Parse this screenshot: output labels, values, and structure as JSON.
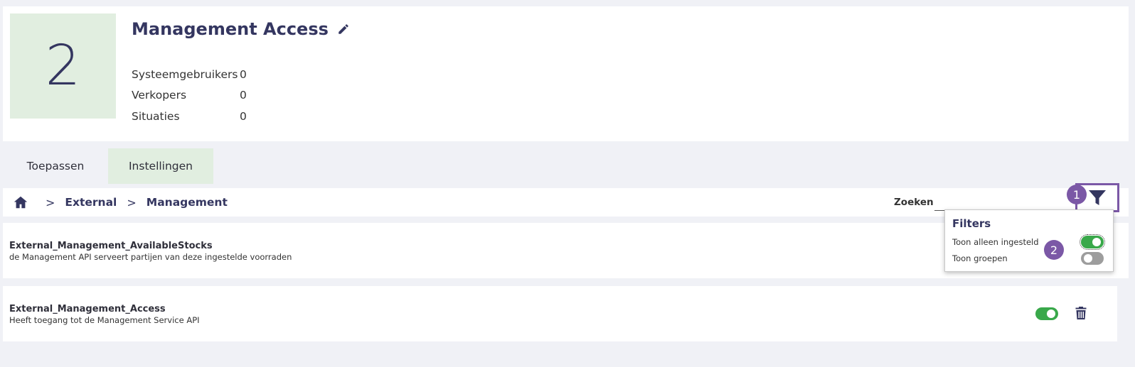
{
  "header": {
    "count": "2",
    "title": "Management Access",
    "stats": [
      {
        "label": "Systeemgebruikers",
        "value": "0"
      },
      {
        "label": "Verkopers",
        "value": "0"
      },
      {
        "label": "Situaties",
        "value": "0"
      }
    ]
  },
  "tabs": [
    {
      "label": "Toepassen",
      "active": false
    },
    {
      "label": "Instellingen",
      "active": true
    }
  ],
  "breadcrumb": {
    "items": [
      "External",
      "Management"
    ],
    "separator": ">"
  },
  "search": {
    "label": "Zoeken",
    "value": "",
    "placeholder": ""
  },
  "steps": [
    "1",
    "2"
  ],
  "filters": {
    "title": "Filters",
    "options": [
      {
        "label": "Toon alleen ingesteld",
        "on": true
      },
      {
        "label": "Toon groepen",
        "on": false
      }
    ]
  },
  "rows": [
    {
      "title": "External_Management_AvailableStocks",
      "description": "de Management API serveert partijen van deze ingestelde voorraden"
    },
    {
      "title": "External_Management_Access",
      "description": "Heeft toegang tot de Management Service API",
      "enabled": true
    }
  ],
  "colors": {
    "primary": "#343660",
    "accent_green": "#39a84a",
    "highlight_purple": "#7b58a6",
    "soft_green": "#e1eee0",
    "background": "#f0f1f6"
  },
  "icons": [
    "edit-icon",
    "home-icon",
    "filter-icon",
    "trash-icon"
  ]
}
